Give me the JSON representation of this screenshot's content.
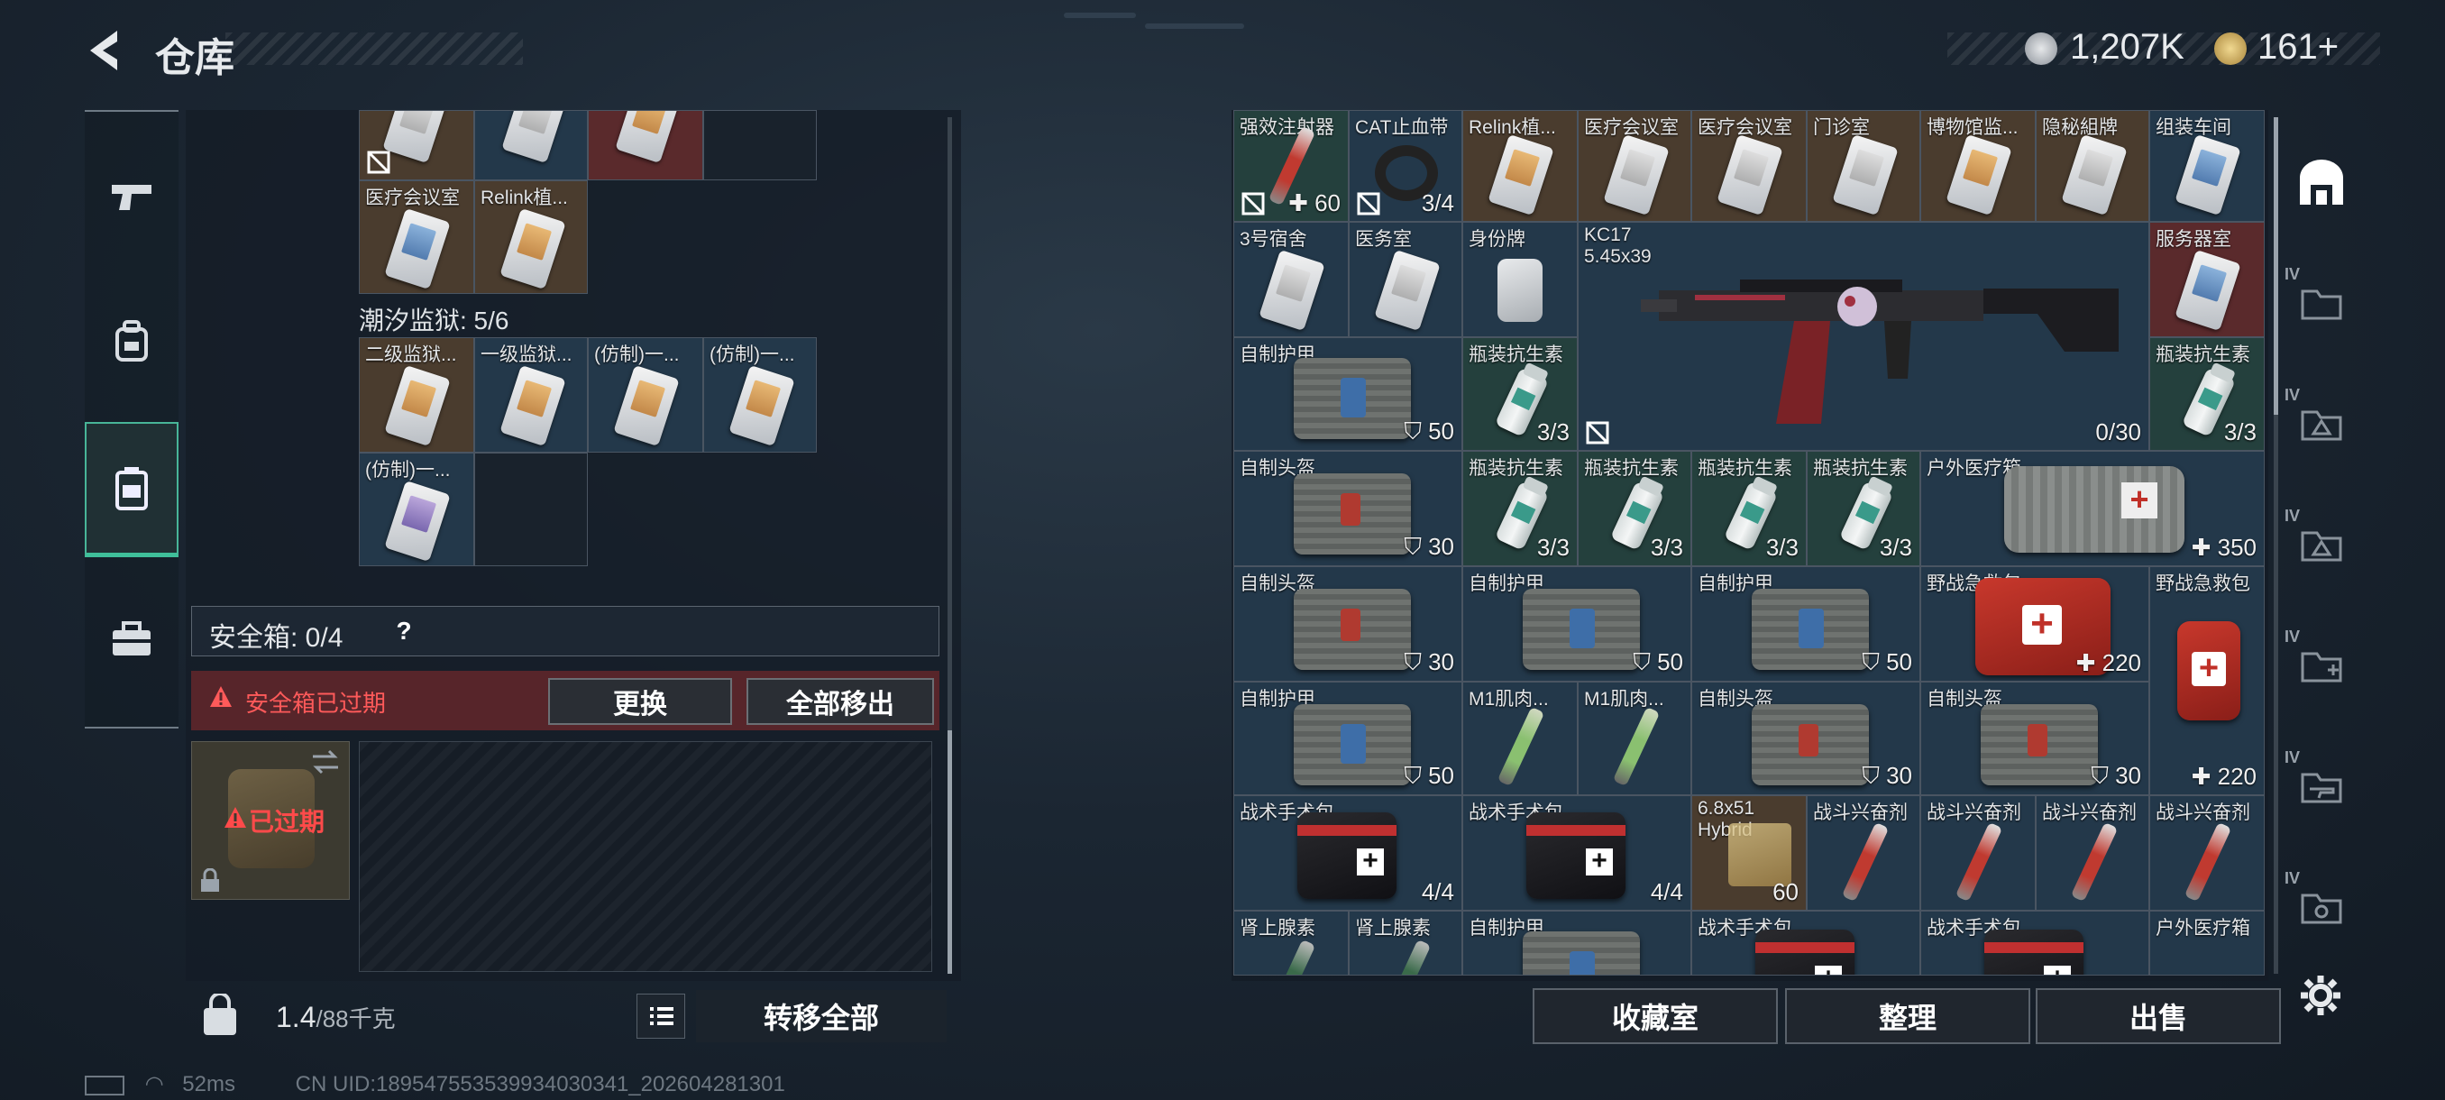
{
  "header": {
    "title": "仓库"
  },
  "currency": {
    "silver": "1,207K",
    "gold": "161+"
  },
  "left_sections": {
    "prison_title": "潮汐监狱: 5/6"
  },
  "left_items_top": [
    {
      "label": "医疗会议室"
    },
    {
      "label": "Relink植..."
    }
  ],
  "left_items_prison": [
    {
      "label": "二级监狱..."
    },
    {
      "label": "一级监狱..."
    },
    {
      "label": "(仿制)一..."
    },
    {
      "label": "(仿制)一..."
    },
    {
      "label": "(仿制)一..."
    }
  ],
  "safe_box": {
    "label": "安全箱: 0/4",
    "help": "?",
    "expired_notice": "安全箱已过期",
    "change_button": "更换",
    "move_all_button": "全部移出",
    "slot_status": "已过期"
  },
  "footer_left": {
    "weight": "1.4",
    "weight_max": "/88千克",
    "transfer_button": "转移全部"
  },
  "status_bar": {
    "ping": "52ms",
    "uid": "CN UID:18954755353993403034​1_202604281301"
  },
  "right_grid": {
    "row0": [
      {
        "label": "强效注射器",
        "count": "60"
      },
      {
        "label": "CAT止血带",
        "count": "3/4"
      },
      {
        "label": "Relink植..."
      },
      {
        "label": "医疗会议室"
      },
      {
        "label": "医疗会议室"
      },
      {
        "label": "门诊室"
      },
      {
        "label": "博物馆监..."
      },
      {
        "label": "隐秘組牌"
      },
      {
        "label": "组装车间"
      }
    ],
    "row1": [
      {
        "label": "3号宿舍"
      },
      {
        "label": "医务室"
      },
      {
        "label": "身份牌"
      },
      {
        "label": "KC17",
        "sub": "5.45x39",
        "count": "0/30"
      },
      {
        "label": "服务器室"
      }
    ],
    "row2": [
      {
        "label": "自制护甲",
        "count": "50"
      },
      {
        "label": "瓶装抗生素",
        "count": "3/3"
      },
      {
        "label": "瓶装抗生素",
        "count": "3/3"
      }
    ],
    "row3": [
      {
        "label": "自制头盔",
        "count": "30"
      },
      {
        "label": "瓶装抗生素",
        "count": "3/3"
      },
      {
        "label": "瓶装抗生素",
        "count": "3/3"
      },
      {
        "label": "瓶装抗生素",
        "count": "3/3"
      },
      {
        "label": "瓶装抗生素",
        "count": "3/3"
      },
      {
        "label": "户外医疗箱",
        "count": "350"
      }
    ],
    "row4": [
      {
        "label": "自制头盔",
        "count": "30"
      },
      {
        "label": "自制护甲",
        "count": "50"
      },
      {
        "label": "自制护甲",
        "count": "50"
      },
      {
        "label": "野战急救包",
        "count": "220"
      },
      {
        "label": "野战急救包"
      }
    ],
    "row5": [
      {
        "label": "自制护甲",
        "count": "50"
      },
      {
        "label": "M1肌肉..."
      },
      {
        "label": "M1肌肉..."
      },
      {
        "label": "自制头盔",
        "count": "30"
      },
      {
        "label": "自制头盔",
        "count": "30"
      },
      {
        "count": "220"
      }
    ],
    "row6": [
      {
        "label": "战术手术包",
        "count": "4/4"
      },
      {
        "label": "战术手术包",
        "count": "4/4"
      },
      {
        "label": "6.8x51",
        "sub": "Hybrid",
        "count": "60"
      },
      {
        "label": "战斗兴奋剂"
      },
      {
        "label": "战斗兴奋剂"
      },
      {
        "label": "战斗兴奋剂"
      },
      {
        "label": "战斗兴奋剂"
      }
    ],
    "row7": [
      {
        "label": "肾上腺素"
      },
      {
        "label": "肾上腺素"
      },
      {
        "label": "自制护甲"
      },
      {
        "label": "战术手术包"
      },
      {
        "label": "战术手术包"
      },
      {
        "label": "户外医疗箱"
      }
    ]
  },
  "right_tabs": [
    "IV",
    "IV",
    "IV",
    "IV",
    "IV",
    "IV"
  ],
  "footer_right": {
    "collection": "收藏室",
    "sort": "整理",
    "sell": "出售"
  },
  "colors": {
    "accent": "#3fbf9a",
    "danger": "#ff5a5a",
    "expired_bg": "#57252a"
  }
}
